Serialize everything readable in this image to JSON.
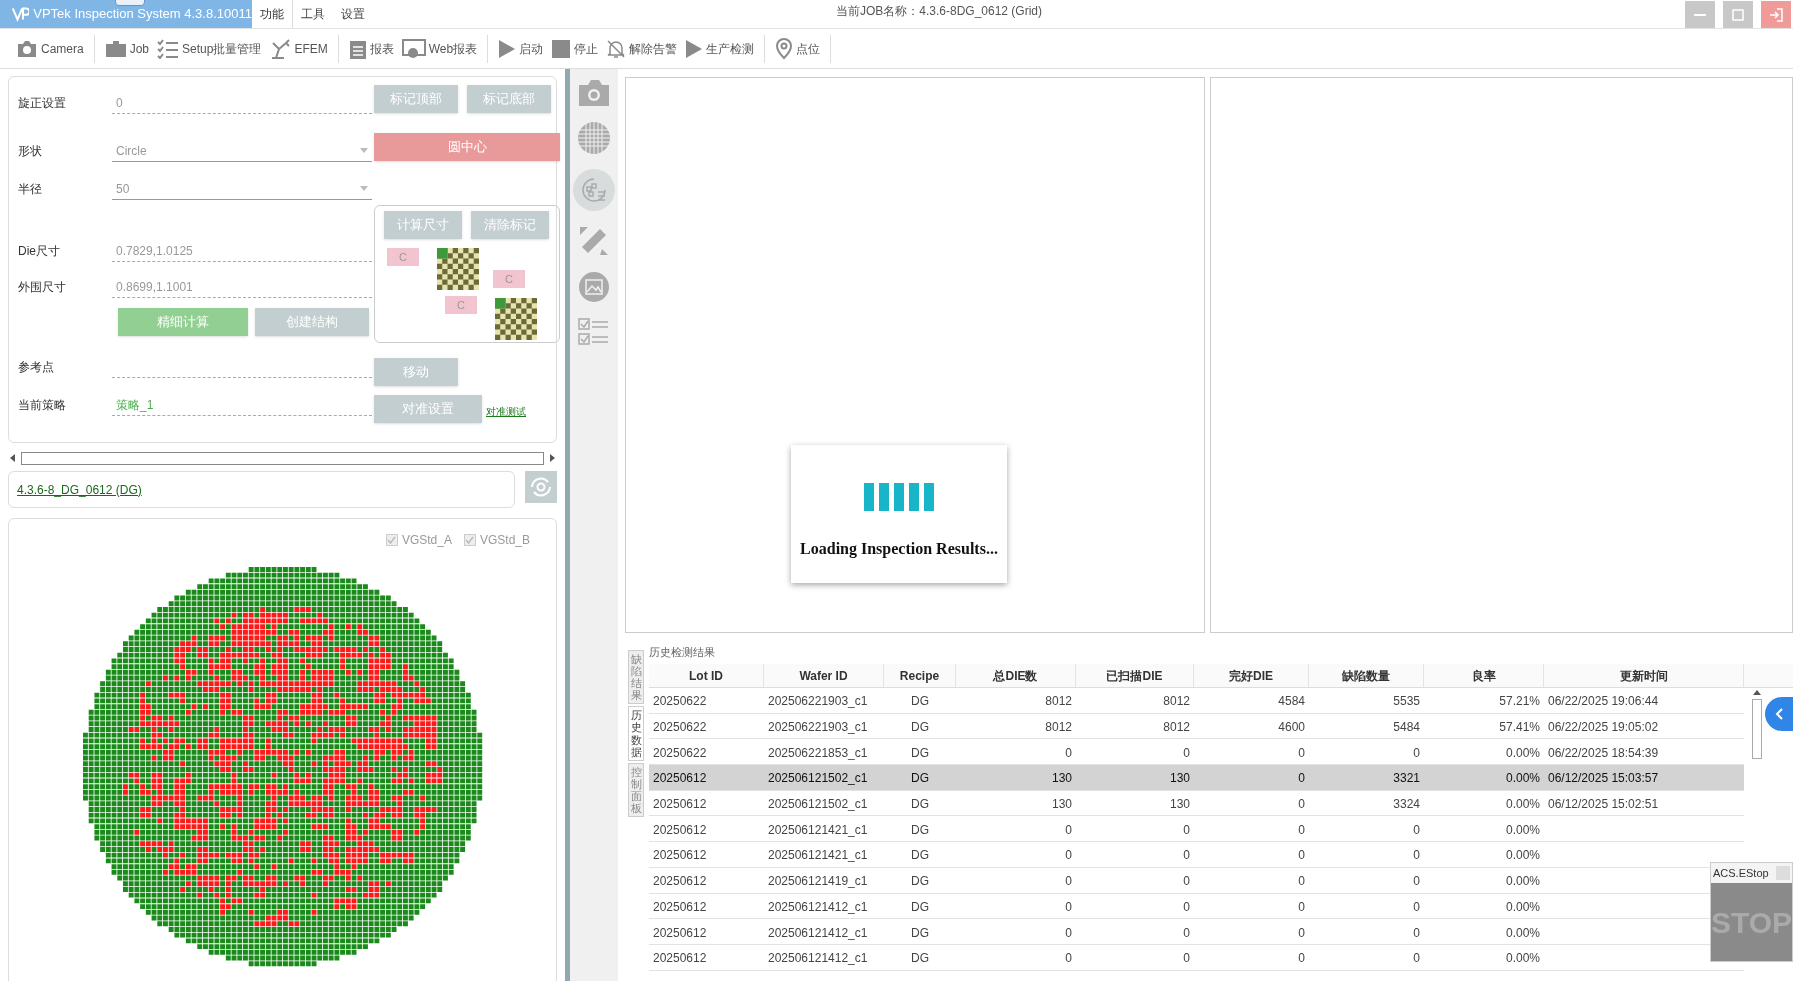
{
  "title_bar": {
    "title": "VPTek Inspection System 4.3.8.10011",
    "menu": [
      {
        "label": "功能",
        "selected": true
      },
      {
        "label": "工具",
        "selected": false
      },
      {
        "label": "设置",
        "selected": false
      }
    ],
    "job_name": "当前JOB名称：4.3.6-8DG_0612 (Grid)"
  },
  "toolbar": [
    {
      "label": "Camera"
    },
    {
      "label": "Job"
    },
    {
      "label": "Setup批量管理"
    },
    {
      "label": "EFEM"
    },
    {
      "label": "报表"
    },
    {
      "label": "Web报表"
    },
    {
      "label": "启动"
    },
    {
      "label": "停止"
    },
    {
      "label": "解除告警"
    },
    {
      "label": "生产检测"
    },
    {
      "label": "点位"
    }
  ],
  "setup": {
    "rotation": {
      "label": "旋正设置",
      "value": "0"
    },
    "shape": {
      "label": "形状",
      "value": "Circle"
    },
    "radius": {
      "label": "半径",
      "value": "50"
    },
    "die_size": {
      "label": "Die尺寸",
      "value": "0.7829,1.0125"
    },
    "outer_size": {
      "label": "外围尺寸",
      "value": "0.8699,1.1001"
    },
    "reference_point": {
      "label": "参考点"
    },
    "strategy": {
      "label": "当前策略",
      "value": "策略_1"
    },
    "buttons": {
      "mark_top": "标记顶部",
      "mark_bottom": "标记底部",
      "circle_center": "圆中心",
      "calc_size": "计算尺寸",
      "clear_marks": "清除标记",
      "fine_calc": "精细计算",
      "create_structure": "创建结构",
      "move": "移动",
      "align_settings": "对准设置",
      "align_test": "对准测试"
    },
    "diagram_labels": [
      "C",
      "C",
      "C"
    ]
  },
  "job_link": "4.3.6-8_DG_0612 (DG)",
  "wafer_view": {
    "checkboxes": [
      {
        "label": "VGStd_A",
        "checked": true
      },
      {
        "label": "VGStd_B",
        "checked": true
      }
    ]
  },
  "loading": {
    "message": "Loading Inspection Results..."
  },
  "side_tabs": [
    {
      "label": "缺陷结果",
      "selected": false
    },
    {
      "label": "历史数据",
      "selected": true
    },
    {
      "label": "控制面板",
      "selected": false
    }
  ],
  "history": {
    "title": "历史检测结果",
    "columns": [
      "Lot ID",
      "Wafer ID",
      "Recipe",
      "总DIE数",
      "已扫描DIE",
      "完好DIE",
      "缺陷数量",
      "良率",
      "更新时间"
    ],
    "rows": [
      {
        "cells": [
          "20250622",
          "202506221903_c1",
          "DG",
          "8012",
          "8012",
          "4584",
          "5535",
          "57.21%",
          "06/22/2025 19:06:44"
        ],
        "selected": false
      },
      {
        "cells": [
          "20250622",
          "202506221903_c1",
          "DG",
          "8012",
          "8012",
          "4600",
          "5484",
          "57.41%",
          "06/22/2025 19:05:02"
        ],
        "selected": false
      },
      {
        "cells": [
          "20250622",
          "202506221853_c1",
          "DG",
          "0",
          "0",
          "0",
          "0",
          "0.00%",
          "06/22/2025 18:54:39"
        ],
        "selected": false
      },
      {
        "cells": [
          "20250612",
          "202506121502_c1",
          "DG",
          "130",
          "130",
          "0",
          "3321",
          "0.00%",
          "06/12/2025 15:03:57"
        ],
        "selected": true
      },
      {
        "cells": [
          "20250612",
          "202506121502_c1",
          "DG",
          "130",
          "130",
          "0",
          "3324",
          "0.00%",
          "06/12/2025 15:02:51"
        ],
        "selected": false
      },
      {
        "cells": [
          "20250612",
          "202506121421_c1",
          "DG",
          "0",
          "0",
          "0",
          "0",
          "0.00%"
        ],
        "selected": false
      },
      {
        "cells": [
          "20250612",
          "202506121421_c1",
          "DG",
          "0",
          "0",
          "0",
          "0",
          "0.00%"
        ],
        "selected": false
      },
      {
        "cells": [
          "20250612",
          "202506121419_c1",
          "DG",
          "0",
          "0",
          "0",
          "0",
          "0.00%"
        ],
        "selected": false
      },
      {
        "cells": [
          "20250612",
          "202506121412_c1",
          "DG",
          "0",
          "0",
          "0",
          "0",
          "0.00%"
        ],
        "selected": false
      },
      {
        "cells": [
          "20250612",
          "202506121412_c1",
          "DG",
          "0",
          "0",
          "0",
          "0",
          "0.00%"
        ],
        "selected": false
      },
      {
        "cells": [
          "20250612",
          "202506121412_c1",
          "DG",
          "0",
          "0",
          "0",
          "0",
          "0.00%"
        ],
        "selected": false
      }
    ]
  },
  "estop": {
    "title": "ACS.EStop",
    "sign": "STOP"
  }
}
